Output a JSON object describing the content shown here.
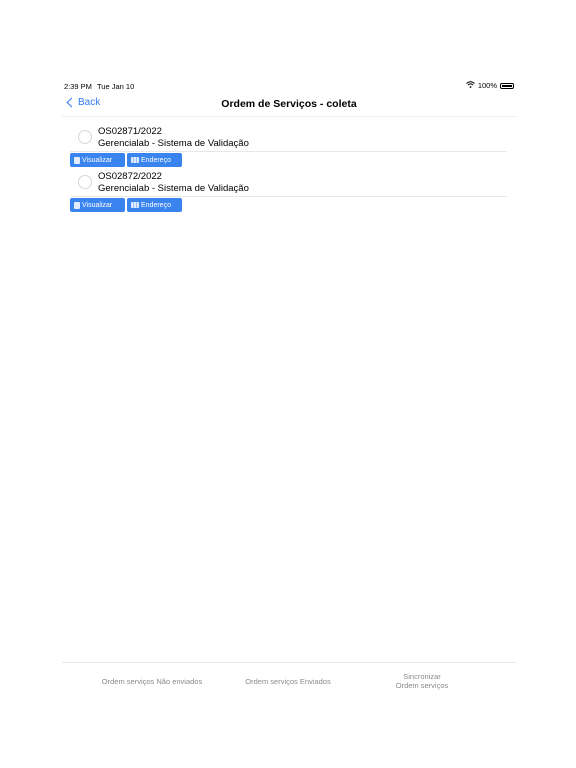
{
  "status_bar": {
    "time": "2:39 PM",
    "date": "Tue Jan 10",
    "battery": "100%"
  },
  "nav": {
    "back_label": "Back",
    "title": "Ordem de Serviços - coleta"
  },
  "orders": [
    {
      "code": "OS02871/2022",
      "client": "Gerencialab - Sistema de Validação"
    },
    {
      "code": "OS02872/2022",
      "client": "Gerencialab - Sistema de Validação"
    }
  ],
  "buttons": {
    "view": "Visualizar",
    "address": "Endereço"
  },
  "tabs": {
    "not_sent": "Ordem serviços Não enviados",
    "sent": "Ordem serviços Enviados",
    "sync_line1": "Sincronizar",
    "sync_line2": "Ordem serviços"
  },
  "colors": {
    "accent": "#3478f6",
    "button": "#3a84f0",
    "tab_text": "#8a8a8a"
  }
}
